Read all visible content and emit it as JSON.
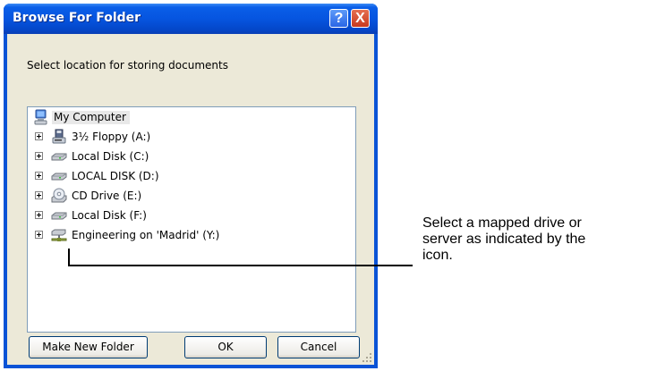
{
  "window": {
    "title": "Browse For Folder",
    "help_glyph": "?",
    "close_glyph": "X"
  },
  "prompt": "Select location for storing documents",
  "tree": {
    "root": {
      "label": "My Computer",
      "icon": "computer-icon"
    },
    "items": [
      {
        "label": "3½ Floppy (A:)",
        "icon": "floppy-drive-icon"
      },
      {
        "label": "Local Disk (C:)",
        "icon": "hard-disk-icon"
      },
      {
        "label": "LOCAL DISK (D:)",
        "icon": "hard-disk-icon"
      },
      {
        "label": "CD Drive (E:)",
        "icon": "cd-drive-icon"
      },
      {
        "label": "Local Disk (F:)",
        "icon": "hard-disk-icon"
      },
      {
        "label": "Engineering on 'Madrid' (Y:)",
        "icon": "network-drive-icon"
      }
    ]
  },
  "buttons": {
    "new_folder": "Make New Folder",
    "ok": "OK",
    "cancel": "Cancel"
  },
  "callout": {
    "lines": [
      "Select a mapped drive or",
      "server as indicated by the",
      "icon."
    ]
  },
  "colors": {
    "titlebar": "#0655e0",
    "dialog_face": "#ece9d8",
    "close_button": "#c7391e"
  }
}
